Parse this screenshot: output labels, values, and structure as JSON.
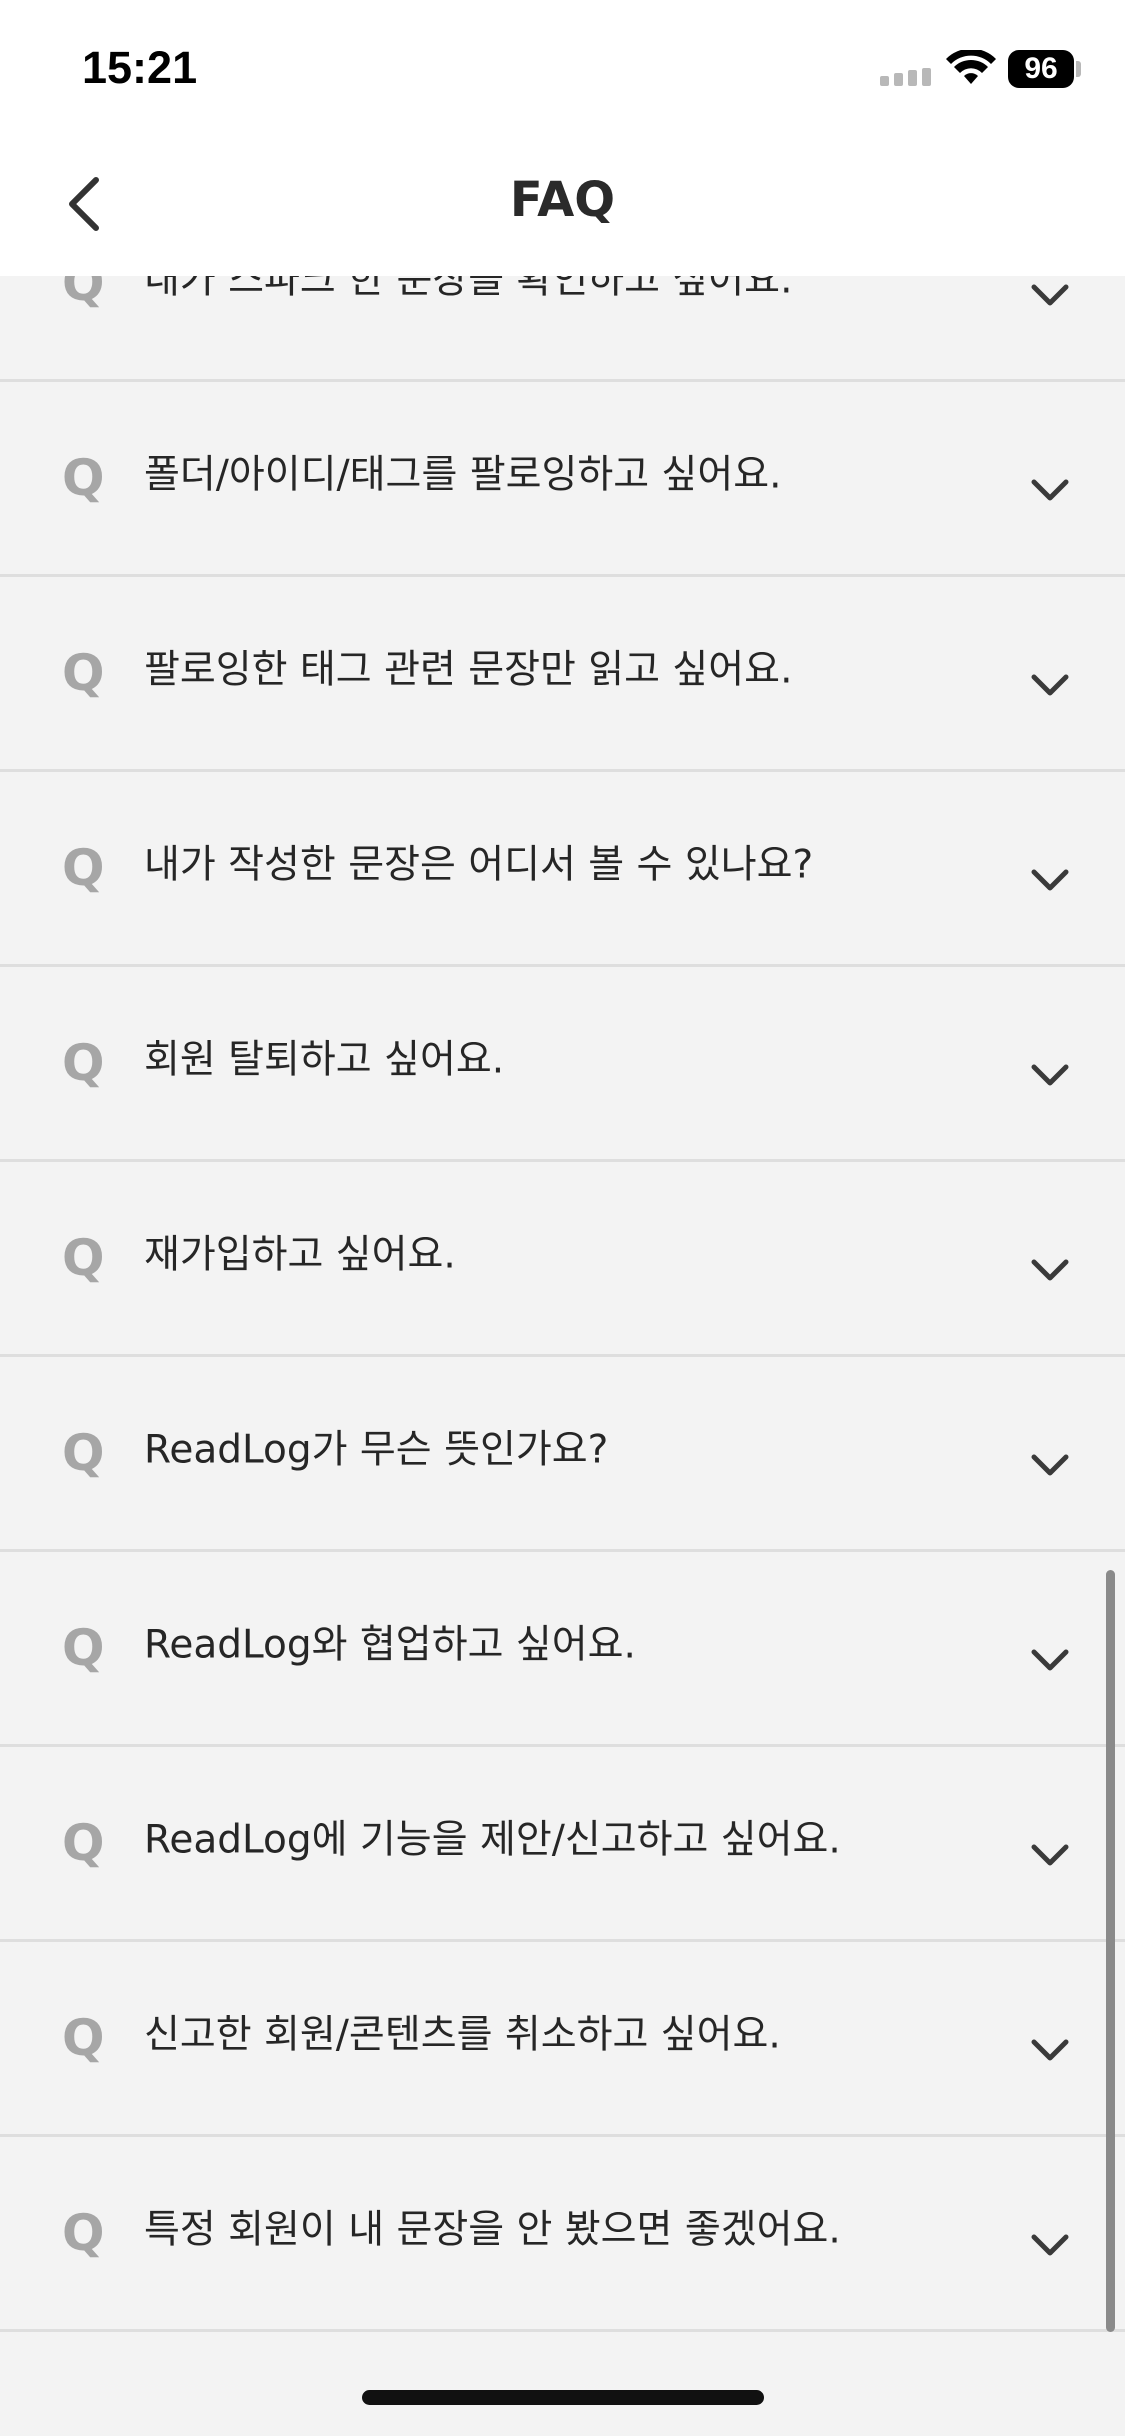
{
  "status_bar": {
    "time": "15:21",
    "battery": "96"
  },
  "header": {
    "title": "FAQ"
  },
  "icons": {
    "back": "chevron-left-icon",
    "expand": "chevron-down-icon",
    "question_marker": "Q"
  },
  "faq": {
    "items": [
      {
        "q": "Q",
        "text": "내가 스파크 한 문장을 확인하고 싶어요."
      },
      {
        "q": "Q",
        "text": "폴더/아이디/태그를 팔로잉하고 싶어요."
      },
      {
        "q": "Q",
        "text": "팔로잉한 태그 관련 문장만 읽고 싶어요."
      },
      {
        "q": "Q",
        "text": "내가 작성한 문장은 어디서 볼 수 있나요?"
      },
      {
        "q": "Q",
        "text": "회원 탈퇴하고 싶어요."
      },
      {
        "q": "Q",
        "text": "재가입하고 싶어요."
      },
      {
        "q": "Q",
        "text": "ReadLog가 무슨 뜻인가요?"
      },
      {
        "q": "Q",
        "text": "ReadLog와 협업하고 싶어요."
      },
      {
        "q": "Q",
        "text": "ReadLog에 기능을 제안/신고하고 싶어요."
      },
      {
        "q": "Q",
        "text": "신고한 회원/콘텐츠를 취소하고 싶어요."
      },
      {
        "q": "Q",
        "text": "특정 회원이 내 문장을 안 봤으면 좋겠어요."
      }
    ]
  }
}
